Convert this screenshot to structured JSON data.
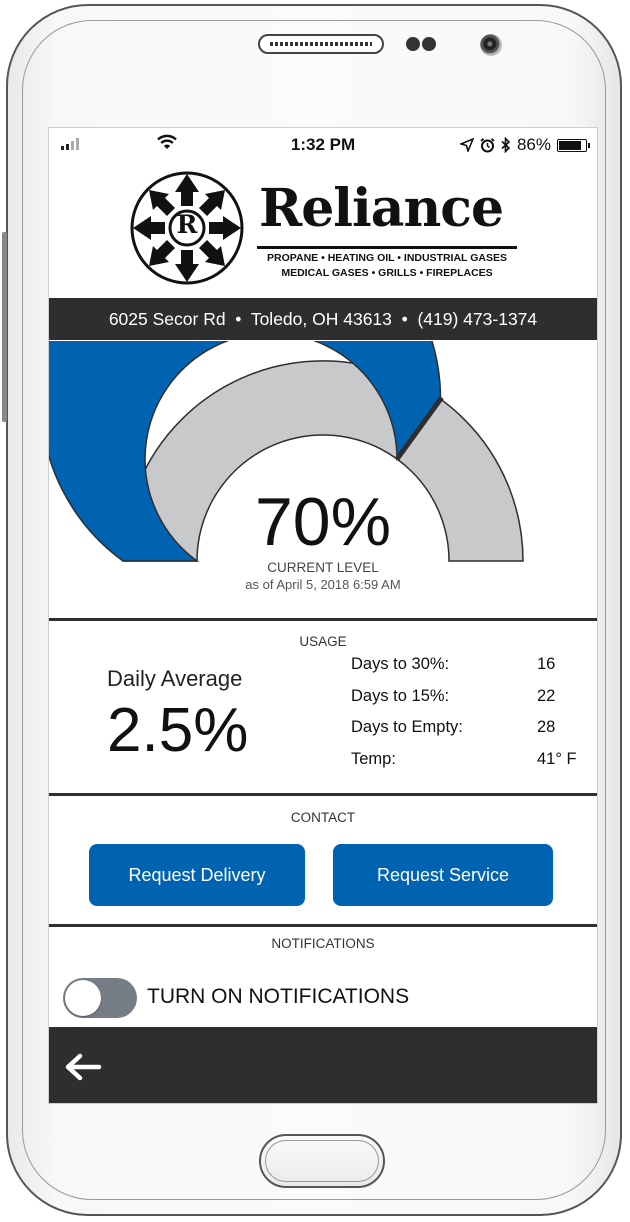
{
  "status_bar": {
    "time": "1:32 PM",
    "battery": "86%",
    "icons": [
      "signal-icon",
      "wifi-icon",
      "location-arrow-icon",
      "alarm-icon",
      "bluetooth-icon",
      "battery-icon"
    ]
  },
  "logo": {
    "emblem_letter": "R",
    "word": "Reliance",
    "tagline_1": "PROPANE • HEATING OIL • INDUSTRIAL GASES",
    "tagline_2": "MEDICAL GASES • GRILLS • FIREPLACES"
  },
  "address_line": "6025 Secor Rd  •  Toledo, OH 43613  •  (419) 473-1374",
  "gauge": {
    "level_percent": 70,
    "level_text": "70%",
    "caption": "CURRENT LEVEL",
    "as_of": "as of April 5, 2018 6:59 AM",
    "fill_color": "#0063b1",
    "empty_color": "#c8c9cb"
  },
  "usage": {
    "title": "USAGE",
    "daily_label": "Daily Average",
    "daily_value": "2.5%",
    "stats": [
      {
        "label": "Days to 30%:",
        "value": "16"
      },
      {
        "label": "Days to 15%:",
        "value": "22"
      },
      {
        "label": "Days to Empty:",
        "value": "28"
      },
      {
        "label": "Temp:",
        "value": "41° F"
      }
    ]
  },
  "contact": {
    "title": "CONTACT",
    "delivery_label": "Request Delivery",
    "service_label": "Request Service",
    "button_color": "#0063b1"
  },
  "notifications": {
    "title": "NOTIFICATIONS",
    "toggle_label": "TURN ON NOTIFICATIONS",
    "enabled": false
  },
  "nav": {
    "back_icon": "arrow-left-icon"
  }
}
